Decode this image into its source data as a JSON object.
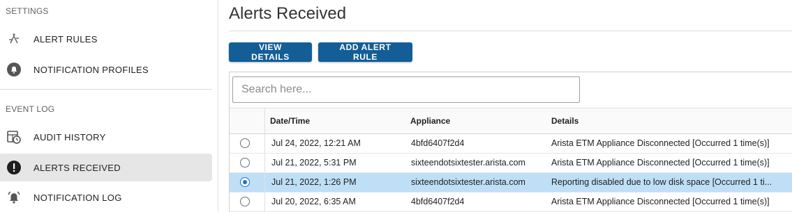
{
  "sidebar": {
    "settings_section": "SETTINGS",
    "settings_items": [
      {
        "label": "ALERT RULES",
        "icon": "alert-rules-icon"
      },
      {
        "label": "NOTIFICATION PROFILES",
        "icon": "notification-profiles-icon"
      }
    ],
    "eventlog_section": "EVENT LOG",
    "eventlog_items": [
      {
        "label": "AUDIT HISTORY",
        "icon": "audit-history-icon"
      },
      {
        "label": "ALERTS RECEIVED",
        "icon": "alerts-received-icon",
        "active": true
      },
      {
        "label": "NOTIFICATION LOG",
        "icon": "notification-log-icon"
      }
    ]
  },
  "main": {
    "title": "Alerts Received",
    "buttons": {
      "view_details": "VIEW DETAILS",
      "add_alert_rule": "ADD ALERT RULE"
    },
    "search": {
      "placeholder": "Search here...",
      "value": ""
    },
    "table": {
      "columns": [
        "Date/Time",
        "Appliance",
        "Details"
      ],
      "rows": [
        {
          "date": "Jul 24, 2022, 12:21 AM",
          "appliance": "4bfd6407f2d4",
          "details": "Arista ETM Appliance Disconnected [Occurred 1 time(s)]",
          "selected": false
        },
        {
          "date": "Jul 21, 2022, 5:31 PM",
          "appliance": "sixteendotsixtester.arista.com",
          "details": "Arista ETM Appliance Disconnected [Occurred 1 time(s)]",
          "selected": false
        },
        {
          "date": "Jul 21, 2022, 1:26 PM",
          "appliance": "sixteendotsixtester.arista.com",
          "details": "Reporting disabled due to low disk space [Occurred 1 ti...",
          "selected": true
        },
        {
          "date": "Jul 20, 2022, 6:35 AM",
          "appliance": "4bfd6407f2d4",
          "details": "Arista ETM Appliance Disconnected [Occurred 1 time(s)]",
          "selected": false
        }
      ]
    }
  },
  "colors": {
    "button": "#135e96",
    "selected_row": "#bfdff7",
    "active_nav": "#e6e6e6",
    "radio_checked": "#1a73c7"
  }
}
